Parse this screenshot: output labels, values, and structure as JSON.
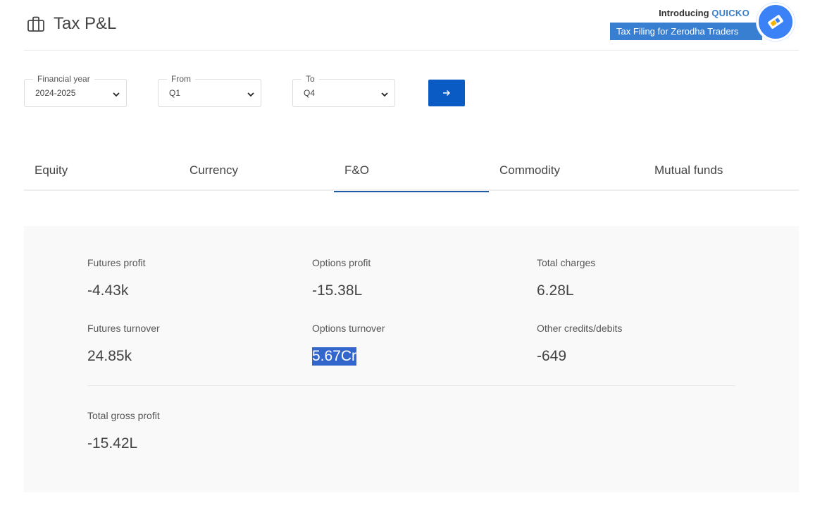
{
  "header": {
    "title": "Tax P&L",
    "title_icon": "briefcase-icon"
  },
  "promo": {
    "intro": "Introducing",
    "brand": "QUICKO",
    "banner": "Tax Filing for Zerodha Traders",
    "logo_icon": "quicko-logo-icon",
    "color": "#387ed1"
  },
  "filters": {
    "financial_year": {
      "label": "Financial year",
      "value": "2024-2025"
    },
    "from": {
      "label": "From",
      "value": "Q1"
    },
    "to": {
      "label": "To",
      "value": "Q4"
    },
    "go_icon": "arrow-right-icon",
    "go_color": "#0b5bc4"
  },
  "tabs": [
    {
      "label": "Equity",
      "active": false
    },
    {
      "label": "Currency",
      "active": false
    },
    {
      "label": "F&O",
      "active": true
    },
    {
      "label": "Commodity",
      "active": false
    },
    {
      "label": "Mutual funds",
      "active": false
    }
  ],
  "summary": {
    "futures_profit": {
      "label": "Futures profit",
      "value": "-4.43k"
    },
    "options_profit": {
      "label": "Options profit",
      "value": "-15.38L"
    },
    "total_charges": {
      "label": "Total charges",
      "value": "6.28L"
    },
    "futures_turnover": {
      "label": "Futures turnover",
      "value": "24.85k"
    },
    "options_turnover": {
      "label": "Options turnover",
      "value": "5.67Cr"
    },
    "other_credits": {
      "label": "Other credits/debits",
      "value": "-649"
    },
    "total_gross_profit": {
      "label": "Total gross profit",
      "value": "-15.42L"
    }
  }
}
